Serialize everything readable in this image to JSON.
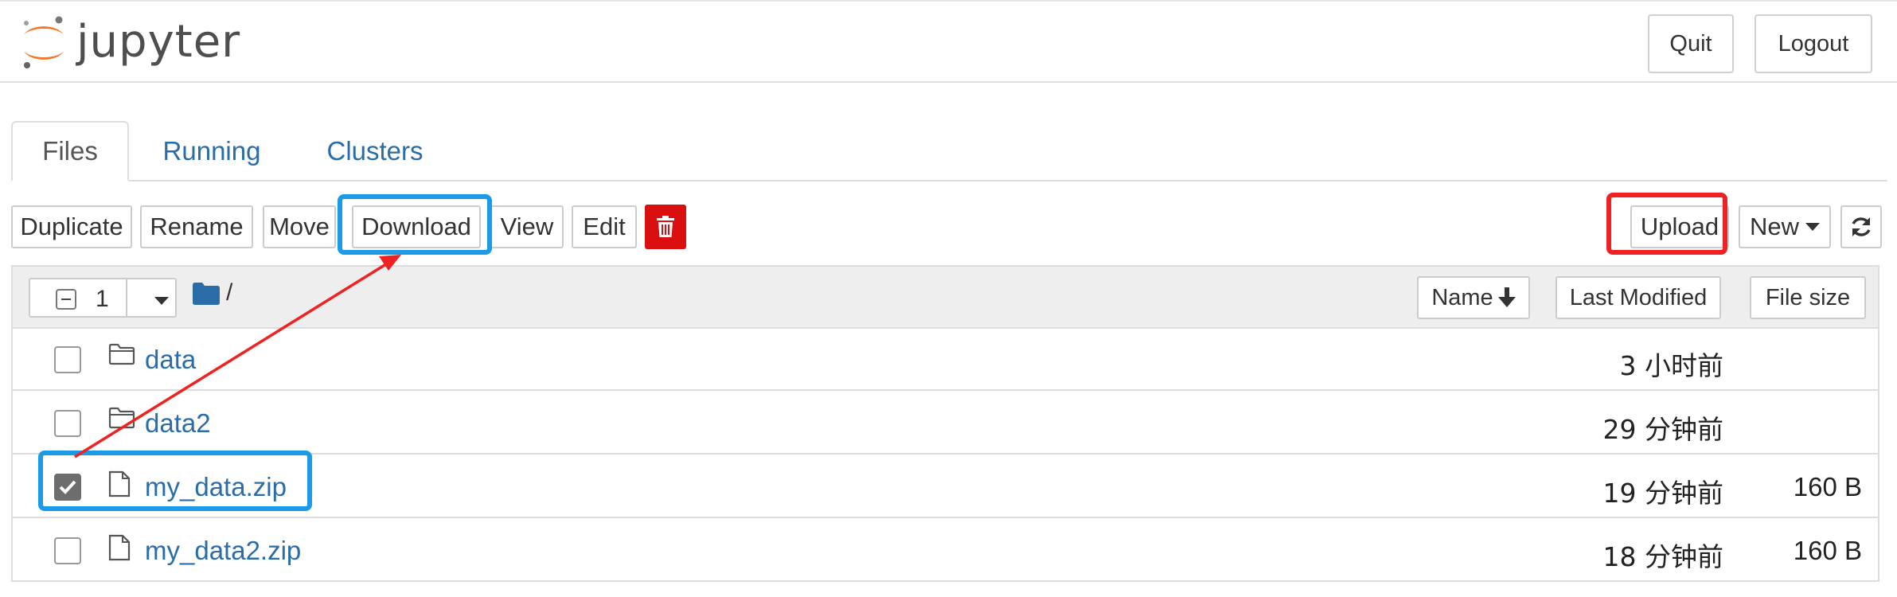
{
  "app": {
    "logo_text": "jupyter"
  },
  "header": {
    "quit_label": "Quit",
    "logout_label": "Logout"
  },
  "tabs": [
    {
      "label": "Files",
      "active": true
    },
    {
      "label": "Running",
      "active": false
    },
    {
      "label": "Clusters",
      "active": false
    }
  ],
  "toolbar": {
    "duplicate_label": "Duplicate",
    "rename_label": "Rename",
    "move_label": "Move",
    "download_label": "Download",
    "view_label": "View",
    "edit_label": "Edit",
    "delete_icon": "trash-icon",
    "upload_label": "Upload",
    "new_label": "New",
    "refresh_icon": "refresh-icon"
  },
  "list_header": {
    "selected_count": "1",
    "breadcrumb_path": "/",
    "sort_name_label": "Name",
    "sort_modified_label": "Last Modified",
    "sort_size_label": "File size"
  },
  "files": [
    {
      "name": "data",
      "type": "folder",
      "modified": "3 小时前",
      "size": "",
      "checked": false
    },
    {
      "name": "data2",
      "type": "folder",
      "modified": "29 分钟前",
      "size": "",
      "checked": false
    },
    {
      "name": "my_data.zip",
      "type": "file",
      "modified": "19 分钟前",
      "size": "160 B",
      "checked": true
    },
    {
      "name": "my_data2.zip",
      "type": "file",
      "modified": "18 分钟前",
      "size": "160 B",
      "checked": false
    }
  ],
  "colors": {
    "link": "#2a6ca8",
    "delete": "#d9100f",
    "highlight_blue": "#1b9ae8",
    "highlight_red": "#ee2222",
    "logo_orange": "#f37626"
  }
}
